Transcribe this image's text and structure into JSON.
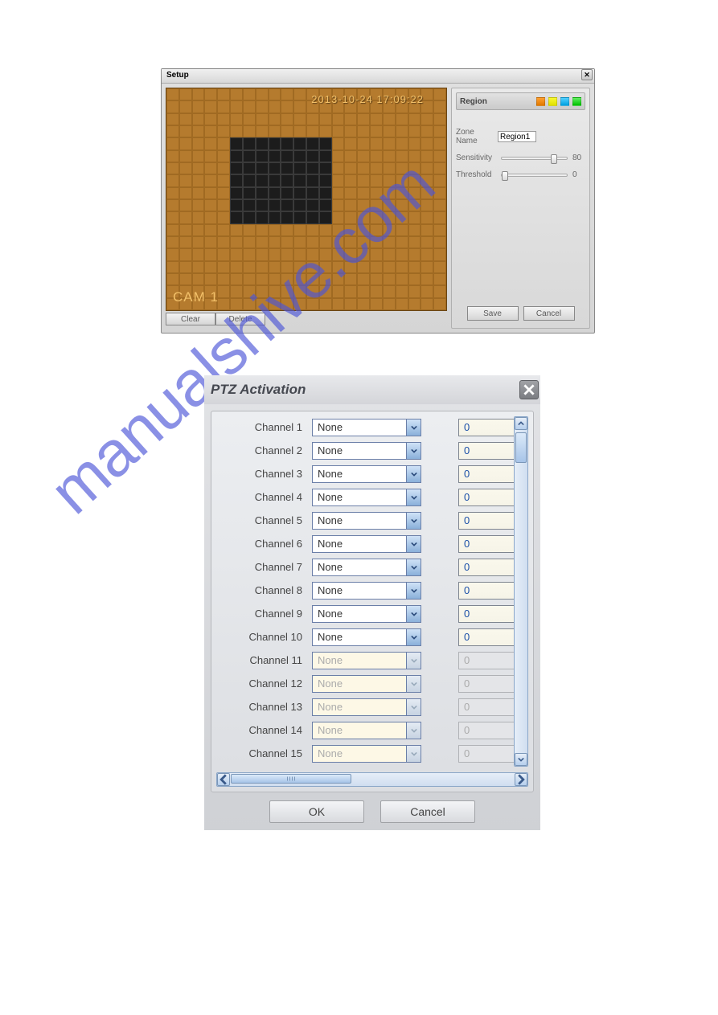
{
  "setup": {
    "title": "Setup",
    "timestamp": "2013-10-24 17:09:22",
    "camera_label": "CAM 1",
    "clear_label": "Clear",
    "delete_label": "Delete",
    "region": {
      "header_label": "Region",
      "swatches": [
        "orange",
        "yellow",
        "cyan",
        "green"
      ],
      "zone_name_label": "Zone Name",
      "zone_name_value": "Region1",
      "sensitivity_label": "Sensitivity",
      "sensitivity_value": "80",
      "threshold_label": "Threshold",
      "threshold_value": "0",
      "save_label": "Save",
      "cancel_label": "Cancel"
    },
    "grid": {
      "cols": 22,
      "rows": 18,
      "selection": {
        "col_start": 5,
        "col_end": 12,
        "row_start": 4,
        "row_end": 10
      }
    }
  },
  "ptz": {
    "title": "PTZ Activation",
    "ok_label": "OK",
    "cancel_label": "Cancel",
    "channels": [
      {
        "label": "Channel 1",
        "option": "None",
        "value": "0",
        "disabled": false
      },
      {
        "label": "Channel 2",
        "option": "None",
        "value": "0",
        "disabled": false
      },
      {
        "label": "Channel 3",
        "option": "None",
        "value": "0",
        "disabled": false
      },
      {
        "label": "Channel 4",
        "option": "None",
        "value": "0",
        "disabled": false
      },
      {
        "label": "Channel 5",
        "option": "None",
        "value": "0",
        "disabled": false
      },
      {
        "label": "Channel 6",
        "option": "None",
        "value": "0",
        "disabled": false
      },
      {
        "label": "Channel 7",
        "option": "None",
        "value": "0",
        "disabled": false
      },
      {
        "label": "Channel 8",
        "option": "None",
        "value": "0",
        "disabled": false
      },
      {
        "label": "Channel 9",
        "option": "None",
        "value": "0",
        "disabled": false
      },
      {
        "label": "Channel 10",
        "option": "None",
        "value": "0",
        "disabled": false
      },
      {
        "label": "Channel 11",
        "option": "None",
        "value": "0",
        "disabled": true
      },
      {
        "label": "Channel 12",
        "option": "None",
        "value": "0",
        "disabled": true
      },
      {
        "label": "Channel 13",
        "option": "None",
        "value": "0",
        "disabled": true
      },
      {
        "label": "Channel 14",
        "option": "None",
        "value": "0",
        "disabled": true
      },
      {
        "label": "Channel 15",
        "option": "None",
        "value": "0",
        "disabled": true
      }
    ]
  },
  "watermark_text": "manualshive.com"
}
